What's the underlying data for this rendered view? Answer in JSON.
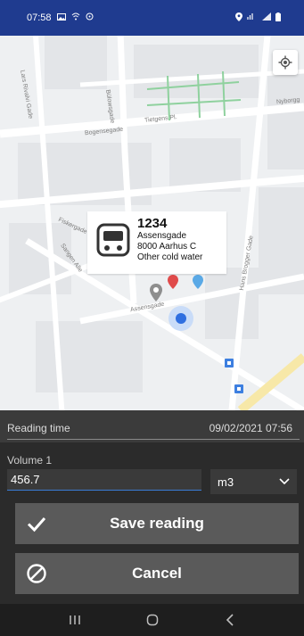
{
  "status_bar": {
    "time": "07:58",
    "left_icons": [
      "gallery-icon",
      "wifi-icon",
      "sync-icon"
    ],
    "right_icons": [
      "location-icon",
      "signal-icon",
      "battery-icon"
    ]
  },
  "map": {
    "street_labels": [
      "Lars Rivalvi Gade",
      "Bülowsgade",
      "Tietgens Pl.",
      "Bogensegade",
      "Nyborgg",
      "Fiskergade",
      "Sangen Alle",
      "Assensgade",
      "Hans Brogger Gade"
    ]
  },
  "popup": {
    "meter_id": "1234",
    "street": "Assensgade",
    "city": "8000 Aarhus C",
    "meter_type": "Other cold water"
  },
  "reading": {
    "time_label": "Reading time",
    "time_value": "09/02/2021 07:56",
    "volume_label": "Volume 1",
    "volume_value": "456.7",
    "unit": "m3"
  },
  "buttons": {
    "save_label": "Save reading",
    "cancel_label": "Cancel"
  },
  "colors": {
    "status_bar": "#1f3b8f",
    "accent": "#3a7bd5",
    "button": "#5a5a5a",
    "panel": "#2b2b2b"
  }
}
